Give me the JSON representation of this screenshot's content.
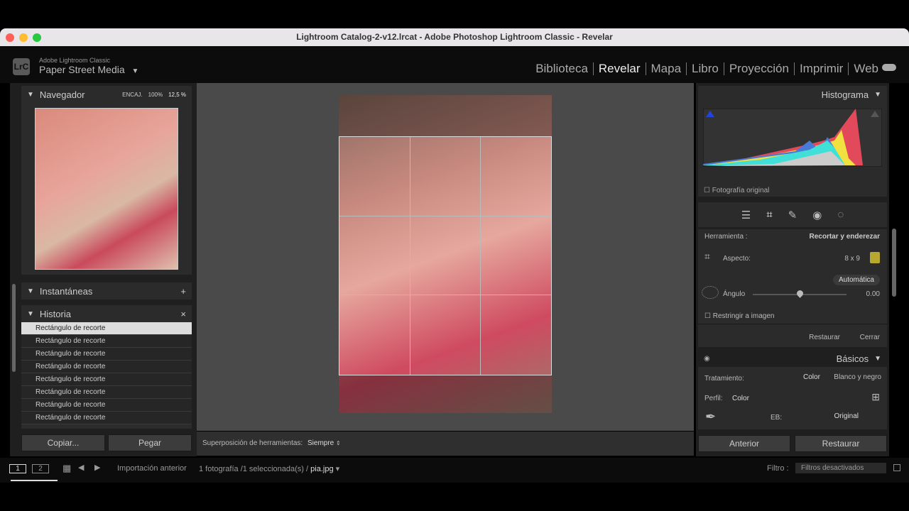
{
  "window": {
    "title": "Lightroom Catalog-2-v12.lrcat - Adobe Photoshop Lightroom Classic - Revelar"
  },
  "identity": {
    "logo": "LrC",
    "app": "Adobe Lightroom Classic",
    "name": "Paper Street Media"
  },
  "modules": [
    "Biblioteca",
    "Revelar",
    "Mapa",
    "Libro",
    "Proyección",
    "Imprimir",
    "Web"
  ],
  "active_module": "Revelar",
  "navigator": {
    "title": "Navegador",
    "fit": "ENCAJ.",
    "zoom100": "100%",
    "zoom_current": "12,5 %"
  },
  "snapshots": {
    "title": "Instantáneas"
  },
  "history": {
    "title": "Historia",
    "items": [
      "Rectángulo de recorte",
      "Rectángulo de recorte",
      "Rectángulo de recorte",
      "Rectángulo de recorte",
      "Rectángulo de recorte",
      "Rectángulo de recorte",
      "Rectángulo de recorte",
      "Rectángulo de recorte"
    ]
  },
  "left_buttons": {
    "copy": "Copiar...",
    "paste": "Pegar"
  },
  "toolbar": {
    "overlay_label": "Superposición de herramientas:",
    "overlay_value": "Siempre"
  },
  "histogram": {
    "title": "Histograma",
    "original_photo": "Fotografía original"
  },
  "crop": {
    "tool_label": "Herramienta :",
    "tool_value": "Recortar y enderezar",
    "aspect_label": "Aspecto:",
    "aspect_value": "8 x 9",
    "auto": "Automática",
    "angle_label": "Ángulo",
    "angle_value": "0.00",
    "angle_fraction": 0.5,
    "constrain": "Restringir a imagen",
    "reset": "Restaurar",
    "close": "Cerrar"
  },
  "basic": {
    "title": "Básicos",
    "treatment_label": "Tratamiento:",
    "color": "Color",
    "bw": "Blanco y negro",
    "profile_label": "Perfil:",
    "profile_value": "Color",
    "wb_label": "EB:",
    "wb_value": "Original"
  },
  "right_buttons": {
    "previous": "Anterior",
    "reset": "Restaurar"
  },
  "filmstrip": {
    "screen1": "1",
    "screen2": "2",
    "source": "Importación anterior",
    "count": "1 fotografía /1 seleccionada(s) /",
    "file": "pia.jpg",
    "filter_label": "Filtro :",
    "filter_value": "Filtros desactivados"
  }
}
